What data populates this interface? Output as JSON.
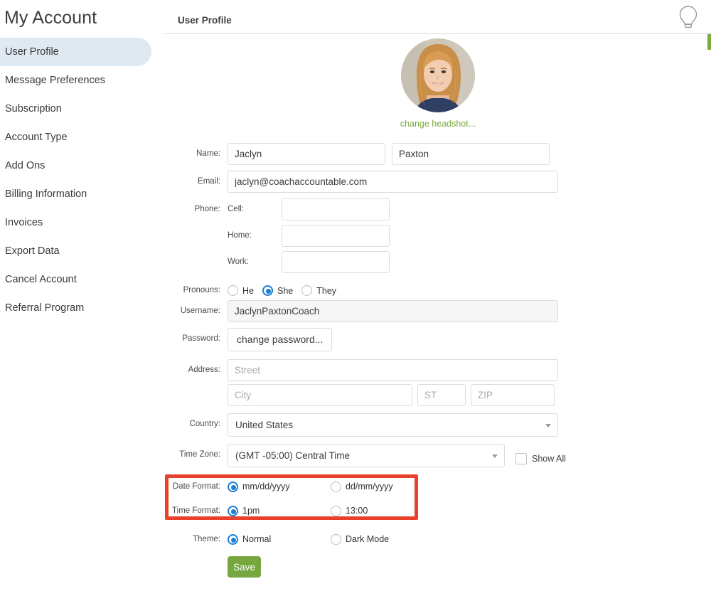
{
  "sidebar": {
    "title": "My Account",
    "items": [
      {
        "label": "User Profile",
        "active": true
      },
      {
        "label": "Message Preferences",
        "active": false
      },
      {
        "label": "Subscription",
        "active": false
      },
      {
        "label": "Account Type",
        "active": false
      },
      {
        "label": "Add Ons",
        "active": false
      },
      {
        "label": "Billing Information",
        "active": false
      },
      {
        "label": "Invoices",
        "active": false
      },
      {
        "label": "Export Data",
        "active": false
      },
      {
        "label": "Cancel Account",
        "active": false
      },
      {
        "label": "Referral Program",
        "active": false
      }
    ]
  },
  "header": {
    "tab_label": "User Profile",
    "help_icon": "lightbulb-icon"
  },
  "avatar": {
    "change_link": "change headshot..."
  },
  "form": {
    "name": {
      "label": "Name:",
      "first_value": "Jaclyn",
      "last_value": "Paxton"
    },
    "email": {
      "label": "Email:",
      "value": "jaclyn@coachaccountable.com"
    },
    "phone": {
      "label": "Phone:",
      "cell_label": "Cell:",
      "cell_value": "",
      "home_label": "Home:",
      "home_value": "",
      "work_label": "Work:",
      "work_value": ""
    },
    "pronouns": {
      "label": "Pronouns:",
      "options": [
        "He",
        "She",
        "They"
      ],
      "selected": "She"
    },
    "username": {
      "label": "Username:",
      "value": "JaclynPaxtonCoach"
    },
    "password": {
      "label": "Password:",
      "button_label": "change password..."
    },
    "address": {
      "label": "Address:",
      "street_placeholder": "Street",
      "street_value": "",
      "city_placeholder": "City",
      "city_value": "",
      "state_placeholder": "ST",
      "state_value": "",
      "zip_placeholder": "ZIP",
      "zip_value": ""
    },
    "country": {
      "label": "Country:",
      "selected": "United States"
    },
    "timezone": {
      "label": "Time Zone:",
      "selected": "(GMT -05:00) Central Time",
      "show_all_label": "Show All",
      "show_all_checked": false
    },
    "date_format": {
      "label": "Date Format:",
      "options": [
        "mm/dd/yyyy",
        "dd/mm/yyyy"
      ],
      "selected": "mm/dd/yyyy"
    },
    "time_format": {
      "label": "Time Format:",
      "options": [
        "1pm",
        "13:00"
      ],
      "selected": "1pm"
    },
    "theme": {
      "label": "Theme:",
      "options": [
        "Normal",
        "Dark Mode"
      ],
      "selected": "Normal"
    },
    "save": {
      "label": "Save"
    }
  },
  "colors": {
    "accent_green": "#76a73f",
    "link_green": "#7bab3e",
    "radio_blue": "#1a7fd4",
    "highlight_red": "#e8402a",
    "sidebar_active": "#dee9f1"
  }
}
